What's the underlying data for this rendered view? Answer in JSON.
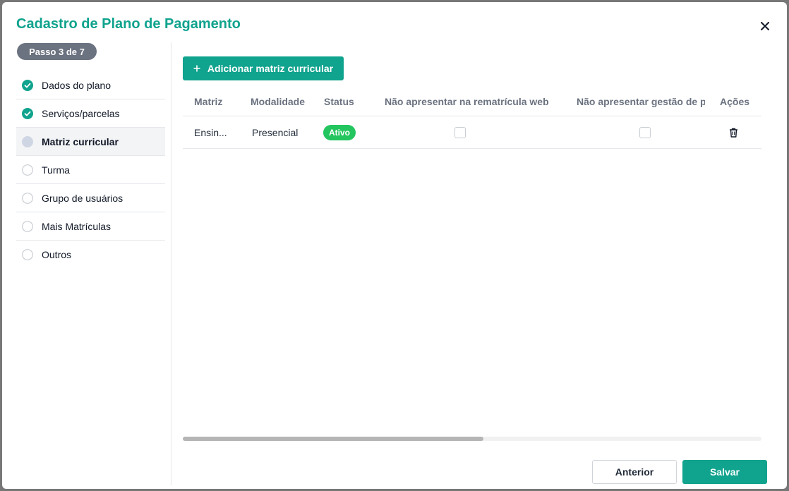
{
  "modal": {
    "title": "Cadastro de Plano de Pagamento",
    "step_badge": "Passo 3 de 7"
  },
  "steps": [
    {
      "label": "Dados do plano",
      "state": "done"
    },
    {
      "label": "Serviços/parcelas",
      "state": "done"
    },
    {
      "label": "Matriz curricular",
      "state": "current"
    },
    {
      "label": "Turma",
      "state": "pending"
    },
    {
      "label": "Grupo de usuários",
      "state": "pending"
    },
    {
      "label": "Mais Matrículas",
      "state": "pending"
    },
    {
      "label": "Outros",
      "state": "pending"
    }
  ],
  "toolbar": {
    "add_label": "Adicionar matriz curricular"
  },
  "table": {
    "headers": {
      "matriz": "Matriz",
      "modalidade": "Modalidade",
      "status": "Status",
      "rematricula": "Não apresentar na rematrícula web",
      "gestao": "Não apresentar gestão de po",
      "acoes": "Ações"
    },
    "rows": [
      {
        "matriz": "Ensin...",
        "modalidade": "Presencial",
        "status": "Ativo",
        "rematricula_checked": false,
        "gestao_checked": false
      }
    ]
  },
  "scrollbar": {
    "position_fraction": 0.0,
    "visible_fraction": 0.52
  },
  "footer": {
    "prev_label": "Anterior",
    "save_label": "Salvar"
  },
  "colors": {
    "brand": "#10a38e",
    "status_active": "#22c55e",
    "badge": "#6b7280"
  },
  "icons": {
    "close": "close-icon",
    "add": "plus-icon",
    "done": "check-circle-icon",
    "delete": "trash-icon"
  }
}
